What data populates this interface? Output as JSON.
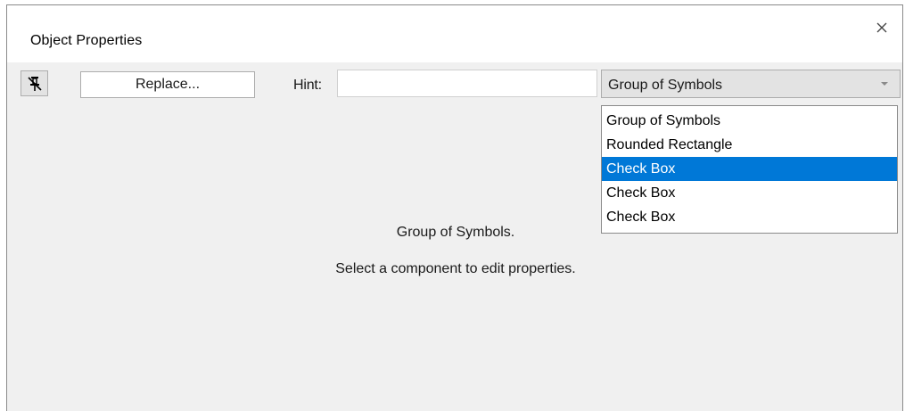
{
  "window": {
    "title": "Object Properties",
    "close_icon": "close-icon"
  },
  "toolbar": {
    "pin_icon": "pin-icon",
    "replace_label": "Replace...",
    "hint_label": "Hint:",
    "hint_value": ""
  },
  "type_combo": {
    "selected_value": "Group of Symbols",
    "options": [
      {
        "label": "Group of Symbols",
        "highlighted": false
      },
      {
        "label": "Rounded Rectangle",
        "highlighted": false
      },
      {
        "label": "Check Box",
        "highlighted": true
      },
      {
        "label": "Check Box",
        "highlighted": false
      },
      {
        "label": "Check Box",
        "highlighted": false
      }
    ]
  },
  "info": {
    "title": "Group of Symbols.",
    "message": "Select a component to edit properties."
  },
  "colors": {
    "selection": "#0078d7",
    "panel_background": "#f0f0f0"
  }
}
